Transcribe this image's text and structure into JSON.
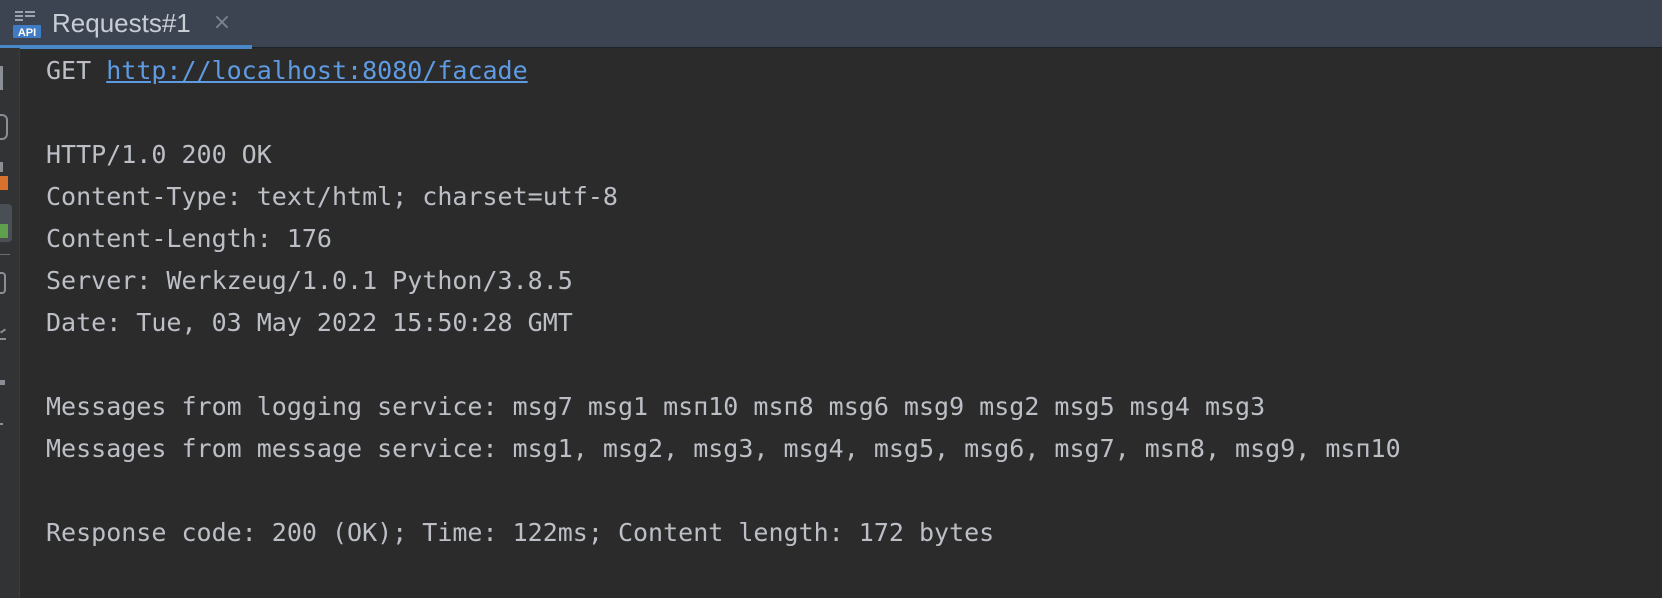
{
  "tab": {
    "icon_text": "API",
    "label": "Requests#1",
    "close_symbol": "×"
  },
  "request": {
    "method": "GET",
    "url": "http://localhost:8080/facade"
  },
  "response": {
    "status_line": "HTTP/1.0 200 OK",
    "headers": [
      "Content-Type: text/html; charset=utf-8",
      "Content-Length: 176",
      "Server: Werkzeug/1.0.1 Python/3.8.5",
      "Date: Tue, 03 May 2022 15:50:28 GMT"
    ],
    "body": [
      "Messages from logging service: msg7 msg1 msп10 msп8 msg6 msg9 msg2 msg5 msg4 msg3",
      "Messages from message service: msg1, msg2, msg3, msg4, msg5, msg6, msg7, msп8, msg9, msп10"
    ],
    "summary": "Response code: 200 (OK); Time: 122ms; Content length: 172 bytes"
  },
  "colors": {
    "background": "#2b2b2b",
    "tabbar": "#3c4452",
    "tab_underline": "#4a88c7",
    "text": "#bcc0c6",
    "link": "#5f9be3"
  }
}
